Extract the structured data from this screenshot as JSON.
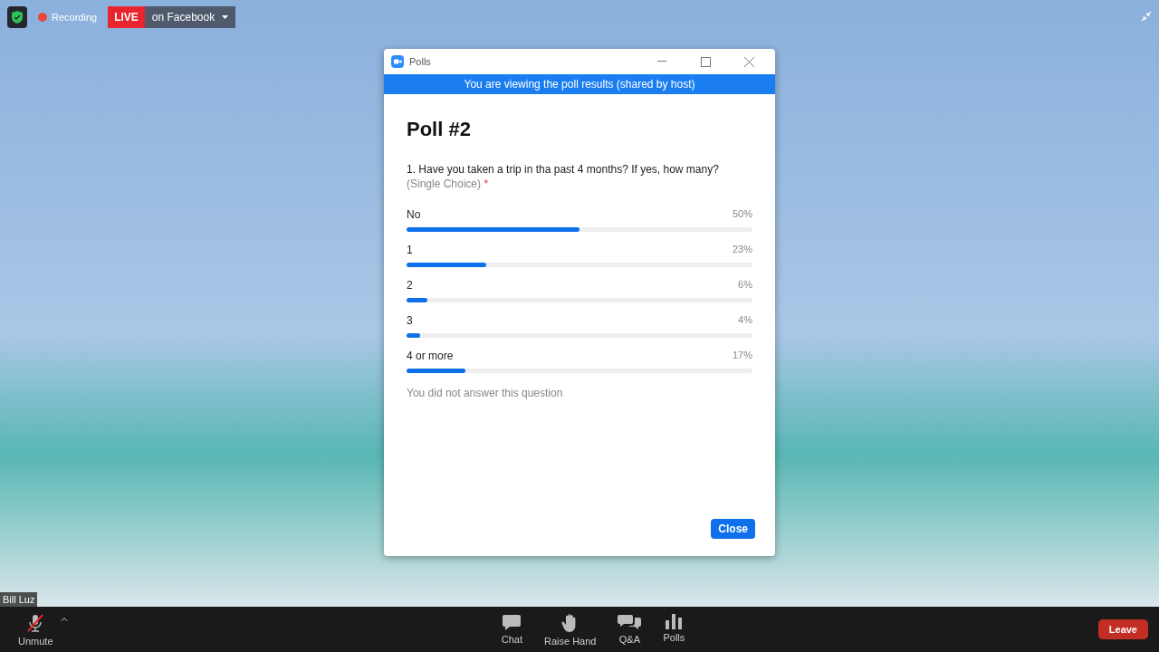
{
  "top_bar": {
    "recording": "Recording",
    "live": "LIVE",
    "stream_target": "on Facebook"
  },
  "participant_name": "Bill Luz",
  "poll_window": {
    "title": "Polls",
    "banner": "You are viewing the poll results (shared by host)",
    "poll_title": "Poll #2",
    "question": "1. Have you taken a trip in tha past 4 months? If yes, how many?",
    "question_type": "(Single Choice)",
    "required_mark": "*",
    "answers": [
      {
        "label": "No",
        "percent": "50%",
        "level": 0.5
      },
      {
        "label": "1",
        "percent": "23%",
        "level": 0.23
      },
      {
        "label": "2",
        "percent": "6%",
        "level": 0.06
      },
      {
        "label": "3",
        "percent": "4%",
        "level": 0.04
      },
      {
        "label": "4 or more",
        "percent": "17%",
        "level": 0.17
      }
    ],
    "note": "You did not answer this question",
    "close_button": "Close"
  },
  "toolbar": {
    "left": {
      "label": "Unmute",
      "kind": "mic-muted"
    },
    "center": [
      {
        "label": "Chat",
        "kind": "chat"
      },
      {
        "label": "Raise Hand",
        "kind": "hand"
      },
      {
        "label": "Q&A",
        "kind": "qa"
      },
      {
        "label": "Polls",
        "kind": "polls"
      }
    ],
    "leave": "Leave"
  }
}
